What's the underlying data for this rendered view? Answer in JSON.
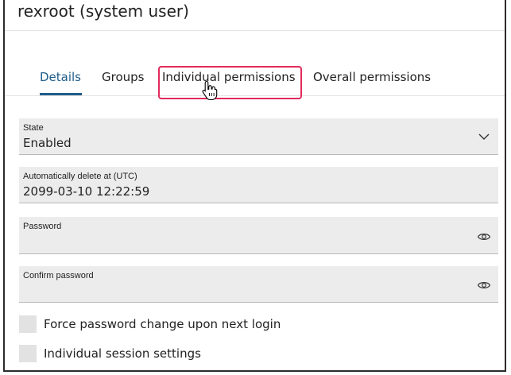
{
  "header": {
    "title": "rexroot (system user)"
  },
  "tabs": [
    {
      "label": "Details",
      "active": true
    },
    {
      "label": "Groups",
      "active": false
    },
    {
      "label": "Individual permissions",
      "active": false,
      "highlighted": true
    },
    {
      "label": "Overall permissions",
      "active": false
    }
  ],
  "form": {
    "state": {
      "label": "State",
      "value": "Enabled",
      "icon": "chevron-down-icon"
    },
    "auto_delete": {
      "label": "Automatically delete at (UTC)",
      "value": "2099-03-10 12:22:59"
    },
    "password": {
      "label": "Password",
      "value": "",
      "icon": "eye-icon"
    },
    "confirm_password": {
      "label": "Confirm password",
      "value": "",
      "icon": "eye-icon"
    },
    "force_password_change": {
      "label": "Force password change upon next login",
      "checked": false
    },
    "individual_session": {
      "label": "Individual session settings",
      "checked": false
    }
  },
  "colors": {
    "accent": "#1f5d8b",
    "highlight": "#e22a5c",
    "field_bg": "#ececec"
  }
}
